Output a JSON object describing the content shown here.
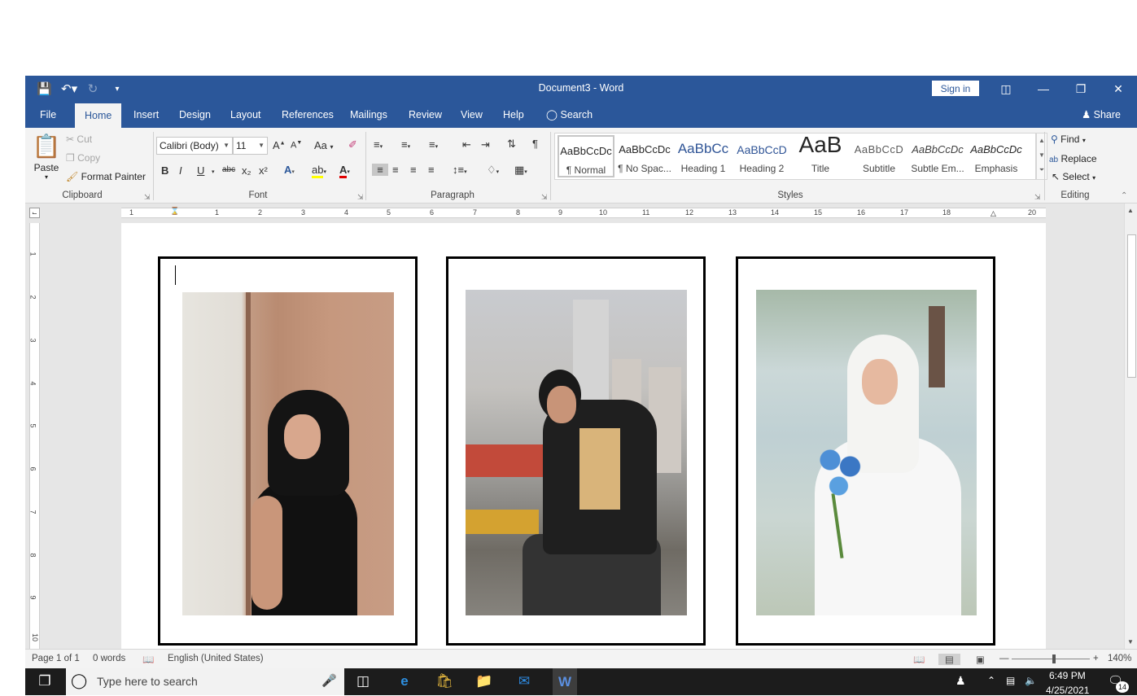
{
  "window": {
    "title": "Document3  -  Word",
    "sign_in": "Sign in"
  },
  "qat": {
    "save": "save-icon",
    "undo": "undo-icon",
    "redo": "redo-icon",
    "customize": "customize-icon"
  },
  "tabs": [
    {
      "label": "File"
    },
    {
      "label": "Home"
    },
    {
      "label": "Insert"
    },
    {
      "label": "Design"
    },
    {
      "label": "Layout"
    },
    {
      "label": "References"
    },
    {
      "label": "Mailings"
    },
    {
      "label": "Review"
    },
    {
      "label": "View"
    },
    {
      "label": "Help"
    },
    {
      "label": "Search"
    }
  ],
  "share": "Share",
  "clipboard": {
    "paste": "Paste",
    "cut": "Cut",
    "copy": "Copy",
    "format_painter": "Format Painter",
    "label": "Clipboard"
  },
  "font": {
    "name": "Calibri (Body)",
    "size": "11",
    "label": "Font",
    "case": "Aa",
    "bold": "B",
    "italic": "I",
    "underline": "U",
    "strike": "abc",
    "sub": "x₂",
    "sup": "x²",
    "grow": "A",
    "shrink": "A"
  },
  "paragraph": {
    "label": "Paragraph"
  },
  "styles": {
    "label": "Styles",
    "items": [
      {
        "sample": "AaBbCcDc",
        "name": "¶ Normal"
      },
      {
        "sample": "AaBbCcDc",
        "name": "¶ No Spac..."
      },
      {
        "sample": "AaBbCc",
        "name": "Heading 1"
      },
      {
        "sample": "AaBbCcD",
        "name": "Heading 2"
      },
      {
        "sample": "AaB",
        "name": "Title"
      },
      {
        "sample": "AaBbCcD",
        "name": "Subtitle"
      },
      {
        "sample": "AaBbCcDc",
        "name": "Subtle Em..."
      },
      {
        "sample": "AaBbCcDc",
        "name": "Emphasis"
      }
    ]
  },
  "editing": {
    "find": "Find",
    "replace": "Replace",
    "select": "Select",
    "label": "Editing"
  },
  "ruler": {
    "h": [
      "1",
      "1",
      "2",
      "3",
      "4",
      "5",
      "6",
      "7",
      "8",
      "9",
      "10",
      "11",
      "12",
      "13",
      "14",
      "15",
      "16",
      "17",
      "18",
      "20"
    ],
    "v": [
      "1",
      "2",
      "3",
      "4",
      "5",
      "6",
      "7",
      "8",
      "9",
      "10"
    ]
  },
  "status": {
    "page": "Page 1 of 1",
    "words": "0 words",
    "language": "English (United States)",
    "zoom": "140%"
  },
  "taskbar": {
    "search_placeholder": "Type here to search",
    "time": "6:49 PM",
    "date": "4/25/2021",
    "notifications": "14"
  }
}
